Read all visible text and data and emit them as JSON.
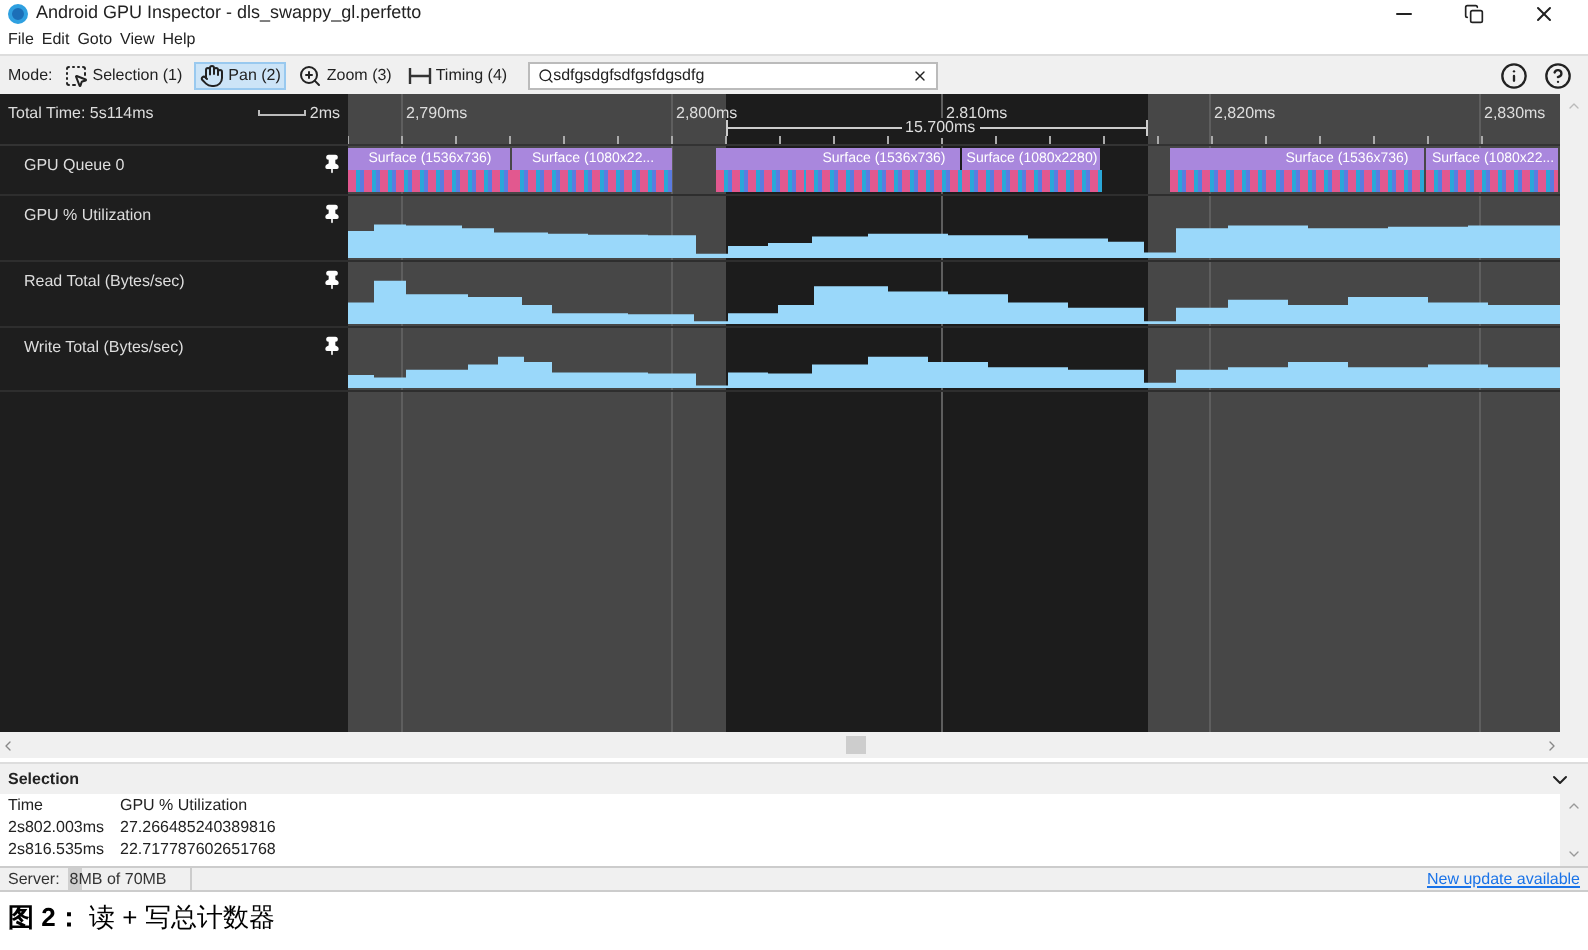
{
  "window": {
    "title": "Android GPU Inspector - dls_swappy_gl.perfetto"
  },
  "menu": [
    "File",
    "Edit",
    "Goto",
    "View",
    "Help"
  ],
  "toolbar": {
    "label": "Mode:",
    "modes": [
      {
        "label": "Selection (1)",
        "kind": "selection",
        "selected": false
      },
      {
        "label": "Pan (2)",
        "kind": "pan",
        "selected": true
      },
      {
        "label": "Zoom (3)",
        "kind": "zoom",
        "selected": false
      },
      {
        "label": "Timing (4)",
        "kind": "timing",
        "selected": false
      }
    ],
    "search": {
      "value": "sdfgsdgfsdfgsfdgsdfg"
    }
  },
  "timeline": {
    "total_time": "Total Time: 5s114ms",
    "scale": "2ms",
    "ticks": [
      "2,790ms",
      "2,800ms",
      "2,810ms",
      "2,820ms",
      "2,830ms"
    ],
    "measure": "15.700ms",
    "tracks": [
      {
        "name": "GPU Queue 0",
        "kind": "slices",
        "slices": [
          "Surface (1536x736)",
          "Surface (1080x22...",
          "Surface (1536x736)",
          "Surface (1080x2280)",
          "Surface (1536x736)",
          "Surface (1080x22..."
        ]
      },
      {
        "name": "GPU % Utilization",
        "kind": "counter"
      },
      {
        "name": "Read Total (Bytes/sec)",
        "kind": "counter"
      },
      {
        "name": "Write Total (Bytes/sec)",
        "kind": "counter"
      }
    ]
  },
  "selection": {
    "title": "Selection",
    "columns": [
      "Time",
      "GPU % Utilization"
    ],
    "rows": [
      [
        "2s802.003ms",
        "27.266485240389816"
      ],
      [
        "2s816.535ms",
        "22.717787602651768"
      ]
    ]
  },
  "status_bar": {
    "server_label": "Server:",
    "memory": {
      "text": "8MB of 70MB",
      "level": 0.11
    },
    "link": "New update available"
  },
  "caption": "**图 2：** 读 + 写总计数器"
}
